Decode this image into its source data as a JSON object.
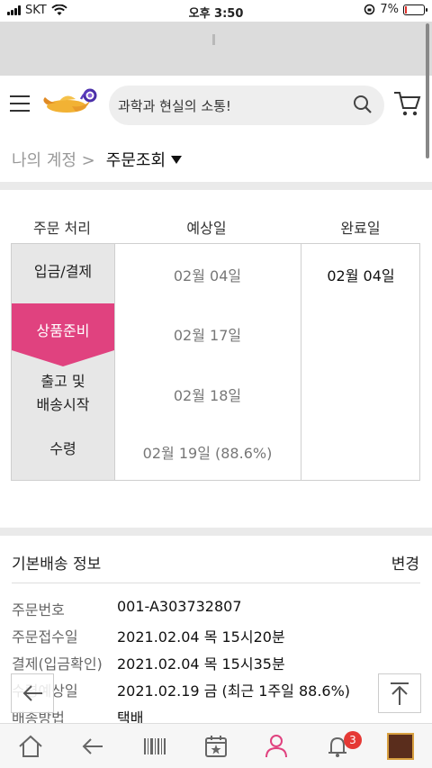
{
  "status_bar": {
    "carrier": "SKT",
    "time": "오후 3:50",
    "battery": "7%"
  },
  "header": {
    "search_placeholder": "과학과 현실의 소통!"
  },
  "breadcrumb": {
    "parent": "나의 계정 >",
    "current": "주문조회"
  },
  "progress": {
    "headers": {
      "step": "주문 처리",
      "estimated": "예상일",
      "completed": "완료일"
    },
    "steps": [
      {
        "label": "입금/결제",
        "estimated": "02월 04일",
        "completed": "02월 04일"
      },
      {
        "label": "상품준비",
        "estimated": "02월 17일",
        "completed": "",
        "active": true
      },
      {
        "label_line1": "출고 및",
        "label_line2": "배송시작",
        "estimated": "02월 18일",
        "completed": ""
      },
      {
        "label": "수령",
        "estimated": "02월 19일 (88.6%)",
        "completed": ""
      }
    ],
    "accent_color": "#e0427f"
  },
  "delivery": {
    "title": "기본배송 정보",
    "change_label": "변경",
    "rows": [
      {
        "label": "주문번호",
        "value": "001-A303732807"
      },
      {
        "label": "주문접수일",
        "value": "2021.02.04 목 15시20분"
      },
      {
        "label": "결제(입금확인)",
        "value": "2021.02.04 목 15시35분"
      },
      {
        "label": "수령예상일",
        "value": "2021.02.19 금 (최근 1주일 88.6%)"
      },
      {
        "label": "배송방법",
        "value": "택배"
      }
    ]
  },
  "tabbar": {
    "notification_count": "3"
  }
}
